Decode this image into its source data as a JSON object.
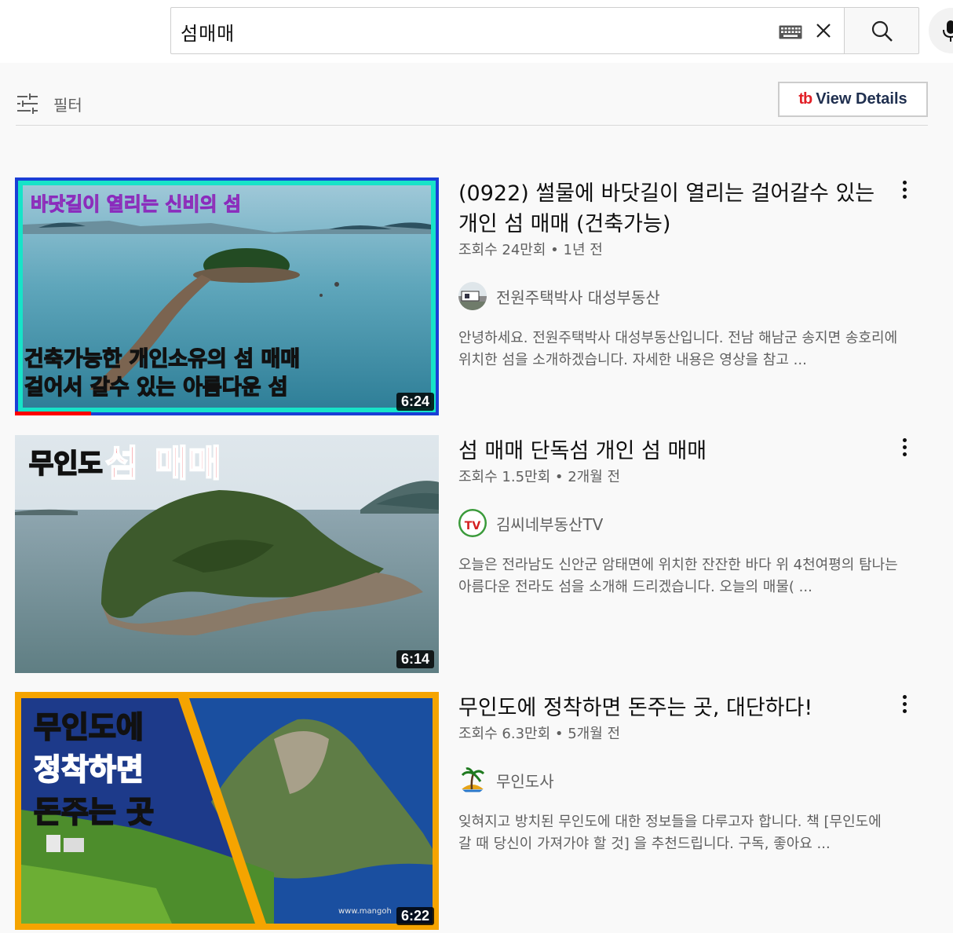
{
  "search": {
    "query": "섬매매"
  },
  "filter": {
    "label": "필터"
  },
  "extension": {
    "logo": "tb",
    "label": "View Details",
    "brand_color": "#e21f26"
  },
  "results": [
    {
      "title": "(0922) 썰물에 바닷길이 열리는 걸어갈수 있는 개인 섬 매매 (건축가능)",
      "stats": "조회수 24만회 • 1년 전",
      "channel": "전원주택박사 대성부동산",
      "description": "안녕하세요. 전원주택박사 대성부동산입니다. 전남 해남군 송지면 송호리에 위치한 섬을 소개하겠습니다. 자세한 내용은 영상을 참고 ...",
      "duration": "6:24",
      "watched_fraction": 0.18,
      "thumbnail_text": {
        "top": "바닷길이 열리는 신비의 섬",
        "line1": "건축가능한 개인소유의 섬 매매",
        "line2": "걸어서 갈수 있는 아름다운 섬"
      }
    },
    {
      "title": "섬 매매 단독섬 개인 섬 매매",
      "stats": "조회수 1.5만회 • 2개월 전",
      "channel": "김씨네부동산TV",
      "description": "오늘은 전라남도 신안군 암태면에 위치한 잔잔한 바다 위 4천여평의 탐나는 아름다운 전라도 섬을 소개해 드리겠습니다. 오늘의 매물( ...",
      "duration": "6:14",
      "thumbnail_text": {
        "prefix": "무인도",
        "word1": "섬",
        "word2": "매매"
      },
      "avatar_text": "TV"
    },
    {
      "title": "무인도에 정착하면 돈주는 곳, 대단하다!",
      "stats": "조회수 6.3만회 • 5개월 전",
      "channel": "무인도사",
      "description": "잊혀지고 방치된 무인도에 대한 정보들을 다루고자 합니다. 책 [무인도에 갈 때 당신이 가져가야 할 것] 을 추천드립니다. 구독, 좋아요 ...",
      "duration": "6:22",
      "thumbnail_text": {
        "line1": "무인도에",
        "line2": "정착하면",
        "line3": "돈주는 곳",
        "watermark": "www.mangoh"
      }
    }
  ],
  "icons": {
    "keyboard": "keyboard-icon",
    "clear": "close-icon",
    "search": "search-icon",
    "mic": "mic-icon",
    "filter": "filter-sliders-icon",
    "more": "more-vertical-icon"
  }
}
